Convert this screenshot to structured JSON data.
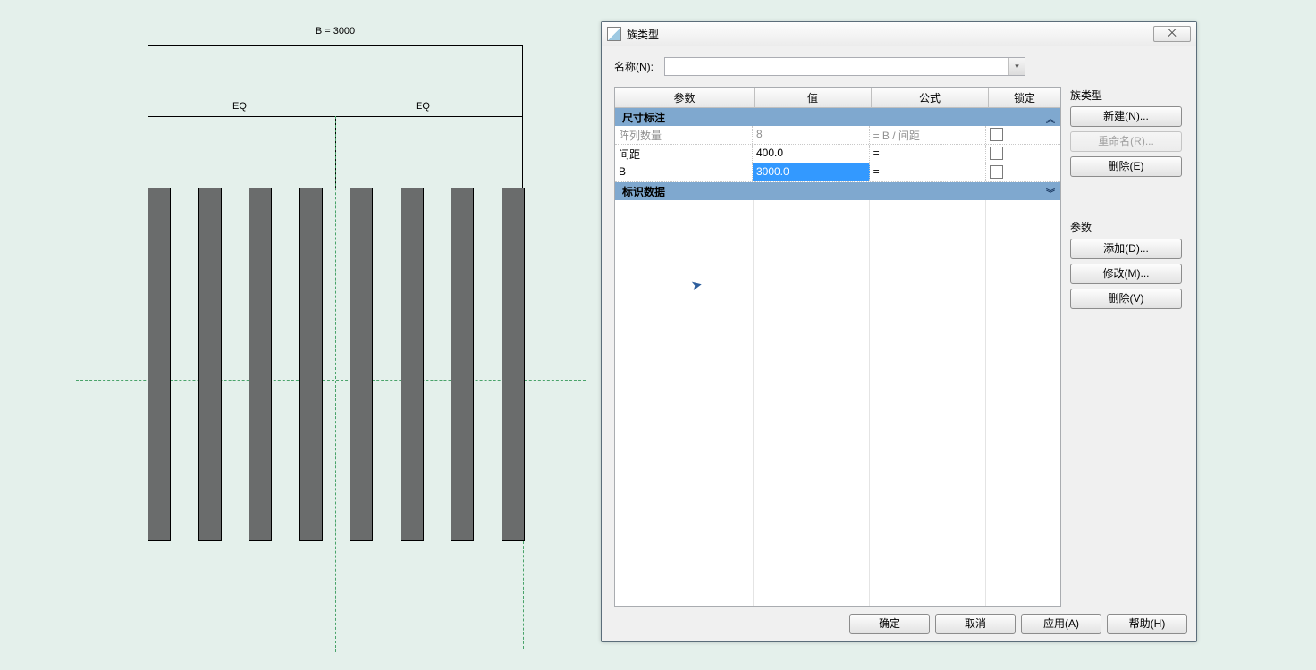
{
  "diagram": {
    "top_label": "B = 3000",
    "eq_left": "EQ",
    "eq_right": "EQ",
    "bar_count": 8
  },
  "dialog": {
    "title": "族类型",
    "close": "⨉",
    "name_label": "名称(N):",
    "headers": {
      "param": "参数",
      "value": "值",
      "formula": "公式",
      "lock": "锁定"
    },
    "groups": {
      "dim": "尺寸标注",
      "id": "标识数据"
    },
    "rows": [
      {
        "param": "阵列数量",
        "value": "8",
        "formula": "= B / 间距",
        "locked": false,
        "disabled": true
      },
      {
        "param": "间距",
        "value": "400.0",
        "formula": "=",
        "locked": false
      },
      {
        "param": "B",
        "value": "3000.0",
        "formula": "=",
        "locked": false,
        "selectedValue": true
      }
    ],
    "side": {
      "group1": "族类型",
      "new": "新建(N)...",
      "rename": "重命名(R)...",
      "delete": "删除(E)",
      "group2": "参数",
      "add": "添加(D)...",
      "modify": "修改(M)...",
      "remove": "删除(V)"
    },
    "bottom": {
      "ok": "确定",
      "cancel": "取消",
      "apply": "应用(A)",
      "help": "帮助(H)"
    }
  }
}
